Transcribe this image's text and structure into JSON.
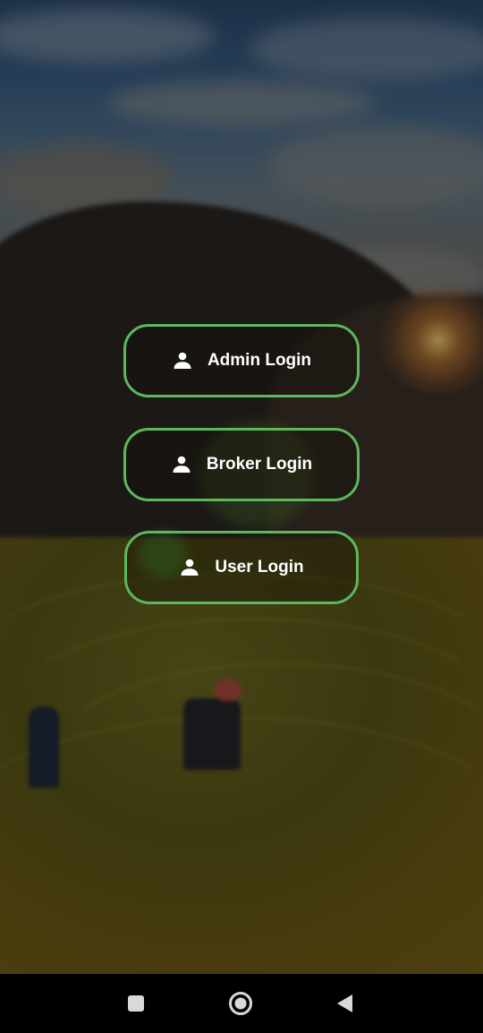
{
  "login_buttons": [
    {
      "label": "Admin Login",
      "icon": "person-icon"
    },
    {
      "label": "Broker Login",
      "icon": "person-icon"
    },
    {
      "label": "User Login",
      "icon": "person-icon"
    }
  ],
  "colors": {
    "button_border": "#5cb85c",
    "button_text": "#ffffff",
    "nav_bar": "#000000",
    "nav_icon": "#d9d9d9"
  },
  "navigation_bar": {
    "buttons": [
      {
        "name": "recents",
        "icon": "square-icon"
      },
      {
        "name": "home",
        "icon": "circle-icon"
      },
      {
        "name": "back",
        "icon": "triangle-back-icon"
      }
    ]
  }
}
